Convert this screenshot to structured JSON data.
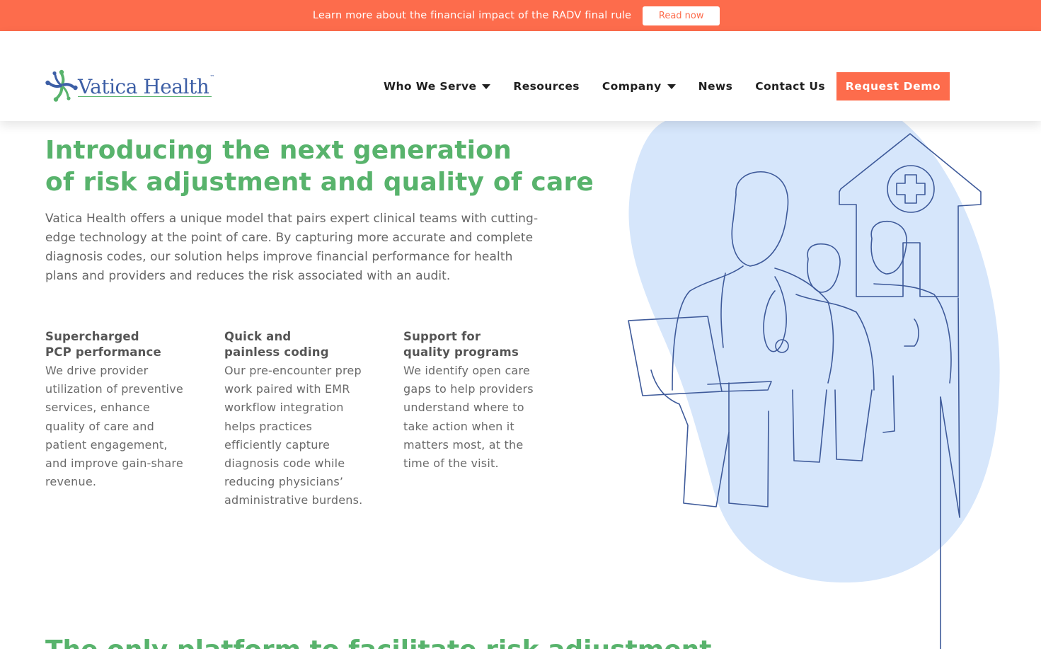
{
  "announcement": {
    "text": "Learn more about the financial impact of the RADV final rule",
    "button_label": "Read now"
  },
  "header": {
    "logo_text": "Vatica Health",
    "logo_tm": "™",
    "nav": [
      {
        "label": "Who We Serve",
        "has_dropdown": true
      },
      {
        "label": "Resources",
        "has_dropdown": false
      },
      {
        "label": "Company",
        "has_dropdown": true
      },
      {
        "label": "News",
        "has_dropdown": false
      },
      {
        "label": "Contact Us",
        "has_dropdown": false
      }
    ],
    "cta_label": "Request Demo"
  },
  "hero": {
    "title_line1": "Introducing the next generation",
    "title_line2": "of risk adjustment and quality of care",
    "body": "Vatica Health offers a unique model that pairs expert clinical teams with cutting-edge technology at the point of care. By capturing more accurate and complete diagnosis codes, our solution helps improve financial performance for health plans and providers and reduces the risk associated with an audit."
  },
  "features": [
    {
      "title_line1": "Supercharged",
      "title_line2": "PCP performance",
      "body": "We drive provider utilization of preventive services, enhance quality of care and patient engagement, and improve gain-share revenue."
    },
    {
      "title_line1": "Quick and",
      "title_line2": "painless coding",
      "body": "Our pre-encounter prep work paired with EMR workflow integration helps practices efficiently capture diagnosis code while reducing physicians’ administrative burdens."
    },
    {
      "title_line1": "Support for",
      "title_line2": "quality programs",
      "body": "We identify open care gaps to help providers understand where to take action when it matters most, at the time of the visit."
    }
  ],
  "next_section_title": "The only platform to facilitate risk adjustment",
  "colors": {
    "accent_orange": "#fd6c4c",
    "brand_green": "#58b36c",
    "brand_blue": "#3d5fa6",
    "blob_blue": "#d6e6fb",
    "line_blue": "#3e5a9a"
  },
  "icons": {
    "logo_mark": "people-circle-logo",
    "dropdown": "caret-down-icon",
    "illustration": "clinicians-line-drawing"
  }
}
